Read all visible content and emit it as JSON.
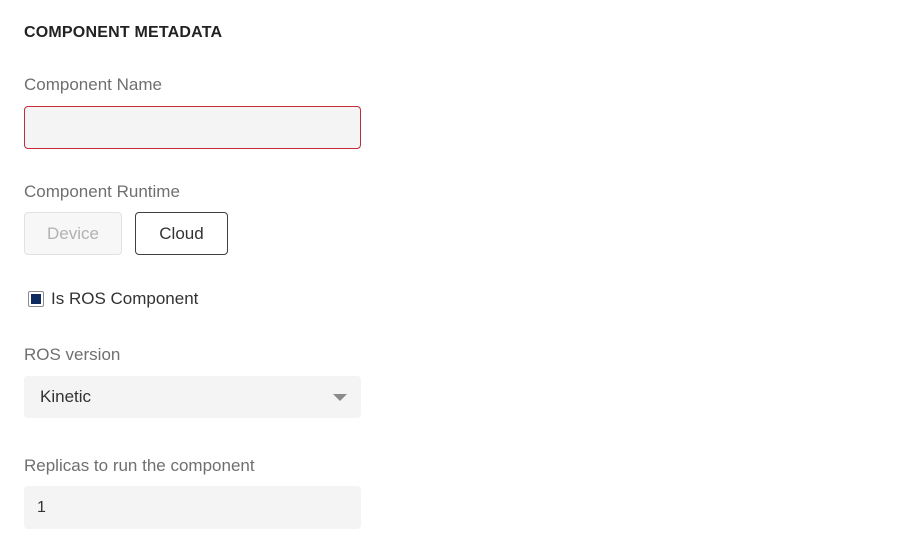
{
  "section": {
    "title": "COMPONENT METADATA"
  },
  "component_name": {
    "label": "Component Name",
    "value": "",
    "placeholder": "",
    "state": "error",
    "border_color": "#c52a3a"
  },
  "component_runtime": {
    "label": "Component Runtime",
    "options": [
      {
        "label": "Device",
        "state": "disabled"
      },
      {
        "label": "Cloud",
        "state": "selected"
      }
    ]
  },
  "ros_component": {
    "label": "Is ROS Component",
    "checked": true,
    "check_color": "#0f2a5e"
  },
  "ros_version": {
    "label": "ROS version",
    "selected": "Kinetic",
    "icon": "chevron-down-icon"
  },
  "replicas": {
    "label": "Replicas to run the component",
    "value": "1"
  }
}
